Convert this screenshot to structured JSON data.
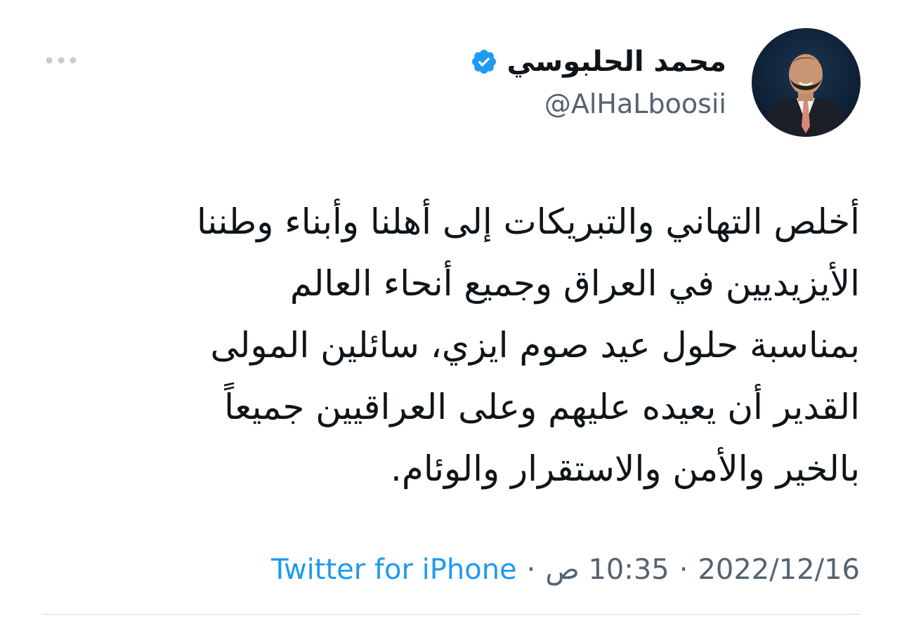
{
  "tweet": {
    "author": {
      "display_name": "محمد الحلبوسي",
      "handle": "@AlHaLboosii",
      "verified": true,
      "avatar_icon": "profile-photo"
    },
    "more_icon": "more-horizontal-icon",
    "text": "أخلص التهاني والتبريكات إلى أهلنا وأبناء وطننا\nالأيزيديين في العراق وجميع أنحاء العالم\nبمناسبة حلول عيد صوم ايزي، سائلين المولى\nالقدير أن يعيده عليهم وعلى العراقيين جميعاً\nبالخير والأمن والاستقرار والوئام.",
    "meta": {
      "date": "2022/12/16",
      "separator": "·",
      "time": "10:35 ص",
      "source": "Twitter for iPhone"
    },
    "colors": {
      "text": "#0f1419",
      "secondary": "#536471",
      "link": "#1d9bf0",
      "verified": "#1d9bf0",
      "divider": "#cfd9de"
    }
  }
}
